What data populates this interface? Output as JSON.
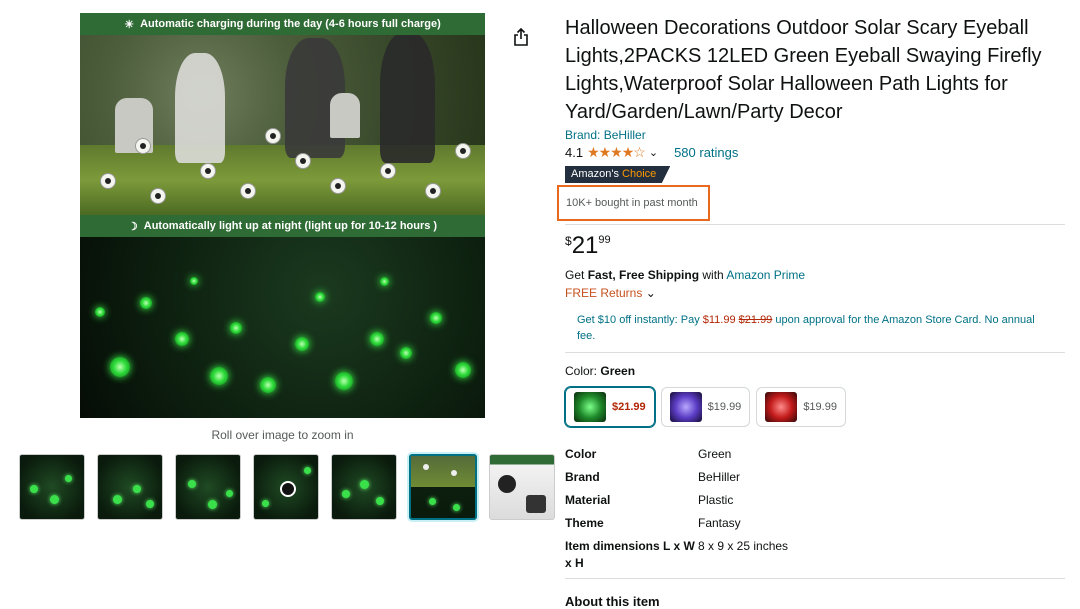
{
  "gallery": {
    "banner_top": "Automatic charging during the day (4-6 hours full charge)",
    "banner_mid": "Automatically light up at night (light up for 10-12 hours )",
    "zoom_caption": "Roll over image to zoom in"
  },
  "product": {
    "title": "Halloween Decorations Outdoor Solar Scary Eyeball Lights,2PACKS 12LED Green Eyeball Swaying Firefly Lights,Waterproof Solar Halloween Path Lights for Yard/Garden/Lawn/Party Decor",
    "brand": "Brand: BeHiller",
    "rating": "4.1",
    "stars": "★★★★☆",
    "ratings_count": "580 ratings",
    "badge_prefix": "Amazon's",
    "badge_choice": "Choice",
    "bought": "10K+ bought in past month",
    "price": {
      "symbol": "$",
      "whole": "21",
      "fraction": "99"
    },
    "shipping_prefix": "Get",
    "shipping_bold": "Fast, Free Shipping",
    "shipping_with": "with",
    "shipping_link": "Amazon Prime",
    "returns": "FREE Returns",
    "promo": {
      "text1": "Get $10 off instantly: Pay",
      "pay": "$11.99",
      "strike": "$21.99",
      "text2": "upon approval for the Amazon Store Card. No annual fee."
    },
    "color_label": "Color:",
    "color_value": "Green",
    "swatches": [
      {
        "price": "$21.99",
        "color": "#1e8a2a"
      },
      {
        "price": "$19.99",
        "color": "#5a3cc4"
      },
      {
        "price": "$19.99",
        "color": "#c21a1a"
      }
    ],
    "specs": [
      {
        "key": "Color",
        "value": "Green"
      },
      {
        "key": "Brand",
        "value": "BeHiller"
      },
      {
        "key": "Material",
        "value": "Plastic"
      },
      {
        "key": "Theme",
        "value": "Fantasy"
      },
      {
        "key": "Item dimensions L x W x H",
        "value": "8 x 9 x 25 inches"
      }
    ],
    "about": "About this item"
  }
}
